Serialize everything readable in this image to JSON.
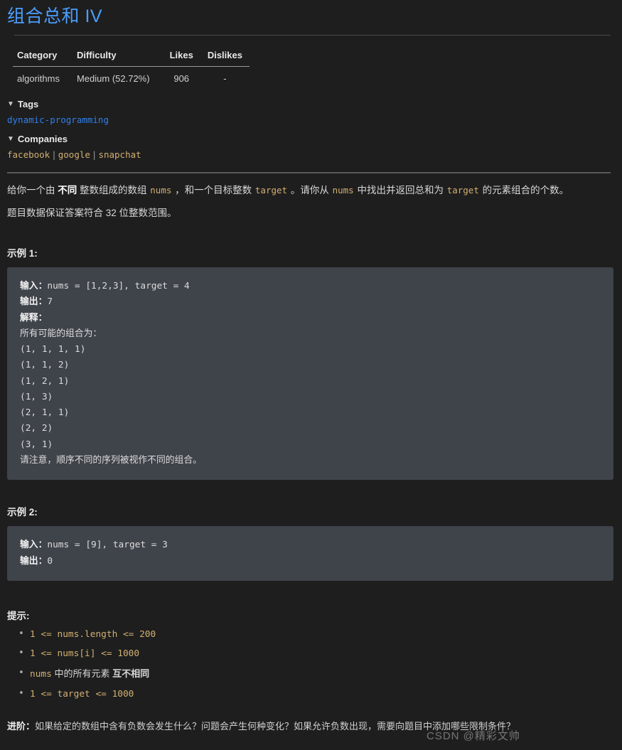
{
  "title": "组合总和 IV",
  "meta_table": {
    "headers": [
      "Category",
      "Difficulty",
      "Likes",
      "Dislikes"
    ],
    "row": {
      "category": "algorithms",
      "difficulty": "Medium (52.72%)",
      "likes": "906",
      "dislikes": "-"
    }
  },
  "tags_section": {
    "caret": "▼",
    "label": "Tags",
    "items": [
      "dynamic-programming"
    ]
  },
  "companies_section": {
    "caret": "▼",
    "label": "Companies",
    "items": [
      "facebook",
      "google",
      "snapchat"
    ],
    "separator": "|"
  },
  "description": {
    "line1_a": "给你一个由 ",
    "line1_strong": "不同",
    "line1_b": " 整数组成的数组 ",
    "line1_code1": "nums",
    "line1_c": " ，和一个目标整数 ",
    "line1_code2": "target",
    "line1_d": " 。请你从 ",
    "line1_code3": "nums",
    "line1_e": " 中找出并返回总和为 ",
    "line1_code4": "target",
    "line1_f": " 的元素组合的个数。",
    "line2": "题目数据保证答案符合 32 位整数范围。"
  },
  "examples": [
    {
      "heading": "示例 1:",
      "input_label": "输入：",
      "input_value": "nums = [1,2,3], target = 4",
      "output_label": "输出：",
      "output_value": "7",
      "explain_label": "解释：",
      "explain_intro": "所有可能的组合为：",
      "combinations": [
        "(1, 1, 1, 1)",
        "(1, 1, 2)",
        "(1, 2, 1)",
        "(1, 3)",
        "(2, 1, 1)",
        "(2, 2)",
        "(3, 1)"
      ],
      "note": "请注意，顺序不同的序列被视作不同的组合。"
    },
    {
      "heading": "示例 2:",
      "input_label": "输入：",
      "input_value": "nums = [9], target = 3",
      "output_label": "输出：",
      "output_value": "0"
    }
  ],
  "hints": {
    "heading": "提示:",
    "items": [
      {
        "code": "1 <= nums.length <= 200"
      },
      {
        "code": "1 <= nums[i] <= 1000"
      },
      {
        "code": "nums",
        "cn_a": " 中的所有元素 ",
        "cn_strong": "互不相同"
      },
      {
        "code": "1 <= target <= 1000"
      }
    ]
  },
  "followup": {
    "label": "进阶：",
    "text": "如果给定的数组中含有负数会发生什么？问题会产生何种变化？如果允许负数出现，需要向题目中添加哪些限制条件？"
  },
  "watermark": "CSDN @精彩文帅",
  "colors": {
    "page_bg": "#1e1e1e",
    "code_bg": "#3f434a",
    "title_blue": "#4a9eff",
    "link_blue": "#2f80ed",
    "code_tan": "#d2b072",
    "text": "#d8d8d8"
  }
}
